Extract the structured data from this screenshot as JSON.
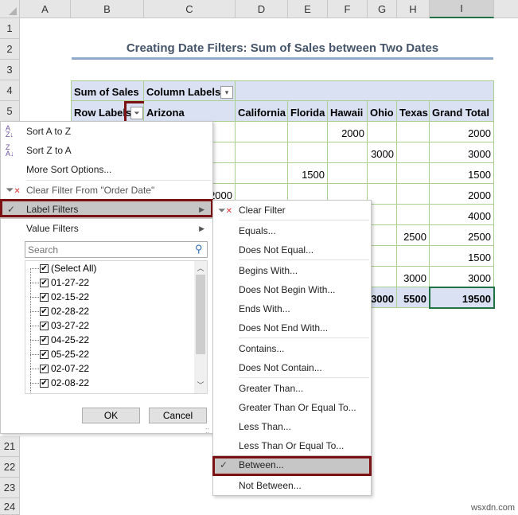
{
  "columns": [
    "A",
    "B",
    "C",
    "D",
    "E",
    "F",
    "G",
    "H",
    "I"
  ],
  "rows": [
    "1",
    "2",
    "3",
    "4",
    "5",
    "21",
    "22",
    "23",
    "24"
  ],
  "title": "Creating Date Filters: Sum of Sales between Two Dates",
  "pivot": {
    "sum_label": "Sum of Sales",
    "column_labels": "Column Labels",
    "row_labels": "Row Labels",
    "headers": [
      "Arizona",
      "California",
      "Florida",
      "Hawaii",
      "Ohio",
      "Texas",
      "Grand Total"
    ],
    "visible_values": {
      "hawaii_r1": "2000",
      "ohio_r2": "3000",
      "florida_r3": "1500",
      "arizona_r4": "2000",
      "texas_r6": "2500",
      "texas_r8": "3000",
      "grand_totals": [
        "2000",
        "3000",
        "1500",
        "2000",
        "4000",
        "2500",
        "1500",
        "3000"
      ],
      "total_row": {
        "ohio": "3000",
        "texas": "5500",
        "grand": "19500"
      }
    }
  },
  "filter_menu": {
    "sort_az": "Sort A to Z",
    "sort_za": "Sort Z to A",
    "more_sort": "More Sort Options...",
    "clear_filter": "Clear Filter From \"Order Date\"",
    "label_filters": "Label Filters",
    "value_filters": "Value Filters",
    "search_placeholder": "Search",
    "items": [
      {
        "label": "(Select All)",
        "checked": true
      },
      {
        "label": "01-27-22",
        "checked": true
      },
      {
        "label": "02-15-22",
        "checked": true
      },
      {
        "label": "02-28-22",
        "checked": true
      },
      {
        "label": "03-27-22",
        "checked": true
      },
      {
        "label": "04-25-22",
        "checked": true
      },
      {
        "label": "05-25-22",
        "checked": true
      },
      {
        "label": "02-07-22",
        "checked": true
      },
      {
        "label": "02-08-22",
        "checked": true
      }
    ],
    "ok": "OK",
    "cancel": "Cancel"
  },
  "submenu": {
    "clear_filter": "Clear Filter",
    "equals": "Equals...",
    "not_equal": "Does Not Equal...",
    "begins": "Begins With...",
    "not_begin": "Does Not Begin With...",
    "ends": "Ends With...",
    "not_end": "Does Not End With...",
    "contains": "Contains...",
    "not_contain": "Does Not Contain...",
    "greater": "Greater Than...",
    "greater_eq": "Greater Than Or Equal To...",
    "less": "Less Than...",
    "less_eq": "Less Than Or Equal To...",
    "between": "Between...",
    "not_between": "Not Between..."
  },
  "watermark": "wsxdn.com"
}
